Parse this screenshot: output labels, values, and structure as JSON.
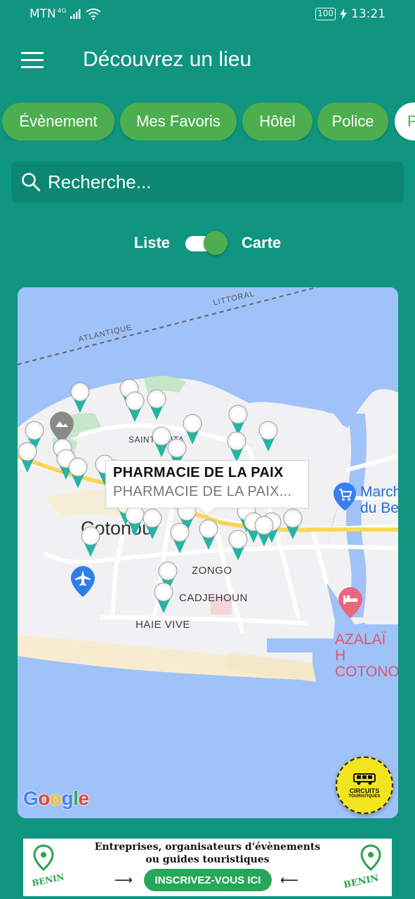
{
  "status_bar": {
    "carrier": "MTN",
    "network": "4G",
    "battery": "100",
    "time": "13:21"
  },
  "app_bar": {
    "title": "Découvrez un lieu"
  },
  "chips": [
    "Évènement",
    "Mes Favoris",
    "Hôtel",
    "Police",
    "P"
  ],
  "search": {
    "placeholder": "Recherche..."
  },
  "view_toggle": {
    "left_label": "Liste",
    "right_label": "Carte",
    "selected": "Carte"
  },
  "map": {
    "labels": {
      "littoral": "LITTORAL",
      "atlantique": "ATLANTIQUE",
      "city": "Cotonou",
      "zongo": "ZONGO",
      "cadjehoun": "CADJEHOUN",
      "haie_vive": "HAIE VIVE",
      "sainte": "SAINTE-RITA",
      "marche_1": "March",
      "marche_2": "du Be",
      "azalai_1": "AZALAÏ H",
      "azalai_2": "COTONO"
    },
    "info_window": {
      "title": "PHARMACIE DE LA PAIX",
      "subtitle": "PHARMACIE DE LA PAIX..."
    },
    "google": "Google",
    "circuit_badge": {
      "line1": "CIRCUITS",
      "line2": "TOURISTIQUES"
    },
    "colors": {
      "water": "#9fc2f9",
      "land": "#f1f1f3",
      "pin": "#24b5a5"
    }
  },
  "banner": {
    "line1": "Entreprises, organisateurs d'évènements",
    "line2": "ou guides touristiques",
    "cta": "INSCRIVEZ-VOUS ICI",
    "brand": "BENIN"
  },
  "colors": {
    "background": "#0f9580",
    "accent": "#4cae4f"
  }
}
